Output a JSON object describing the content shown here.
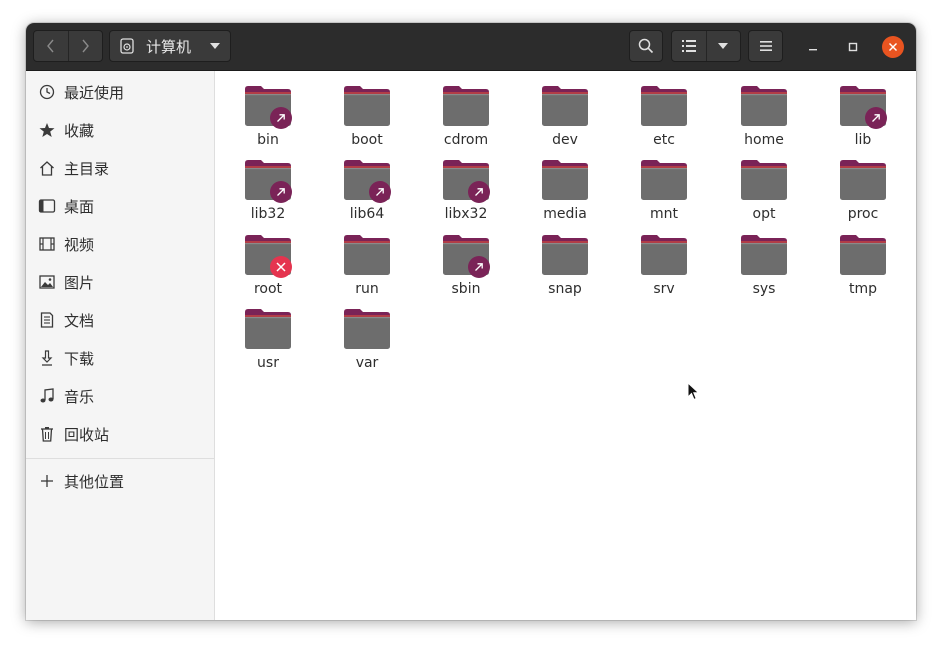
{
  "location": {
    "label": "计算机",
    "icon": "drive-icon"
  },
  "sidebar": {
    "items": [
      {
        "label": "最近使用",
        "icon": "clock-icon"
      },
      {
        "label": "收藏",
        "icon": "star-icon"
      },
      {
        "label": "主目录",
        "icon": "home-icon"
      },
      {
        "label": "桌面",
        "icon": "desktop-icon"
      },
      {
        "label": "视频",
        "icon": "video-icon"
      },
      {
        "label": "图片",
        "icon": "picture-icon"
      },
      {
        "label": "文档",
        "icon": "document-icon"
      },
      {
        "label": "下载",
        "icon": "download-icon"
      },
      {
        "label": "音乐",
        "icon": "music-icon"
      },
      {
        "label": "回收站",
        "icon": "trash-icon"
      }
    ],
    "other_locations": {
      "label": "其他位置",
      "icon": "plus-icon"
    }
  },
  "folders": [
    {
      "name": "bin",
      "emblem": "symlink"
    },
    {
      "name": "boot",
      "emblem": ""
    },
    {
      "name": "cdrom",
      "emblem": ""
    },
    {
      "name": "dev",
      "emblem": ""
    },
    {
      "name": "etc",
      "emblem": ""
    },
    {
      "name": "home",
      "emblem": ""
    },
    {
      "name": "lib",
      "emblem": "symlink"
    },
    {
      "name": "lib32",
      "emblem": "symlink"
    },
    {
      "name": "lib64",
      "emblem": "symlink"
    },
    {
      "name": "libx32",
      "emblem": "symlink"
    },
    {
      "name": "media",
      "emblem": ""
    },
    {
      "name": "mnt",
      "emblem": ""
    },
    {
      "name": "opt",
      "emblem": ""
    },
    {
      "name": "proc",
      "emblem": ""
    },
    {
      "name": "root",
      "emblem": "no-access"
    },
    {
      "name": "run",
      "emblem": ""
    },
    {
      "name": "sbin",
      "emblem": "symlink"
    },
    {
      "name": "snap",
      "emblem": ""
    },
    {
      "name": "srv",
      "emblem": ""
    },
    {
      "name": "sys",
      "emblem": ""
    },
    {
      "name": "tmp",
      "emblem": ""
    },
    {
      "name": "usr",
      "emblem": ""
    },
    {
      "name": "var",
      "emblem": ""
    }
  ],
  "colors": {
    "headerbar": "#2c2c2c",
    "accent": "#e95420",
    "folder_body": "#6d6d6d",
    "folder_tab": "#7a2357",
    "symlink_emblem": "#7a2357",
    "no_access_emblem": "#e5344f"
  }
}
